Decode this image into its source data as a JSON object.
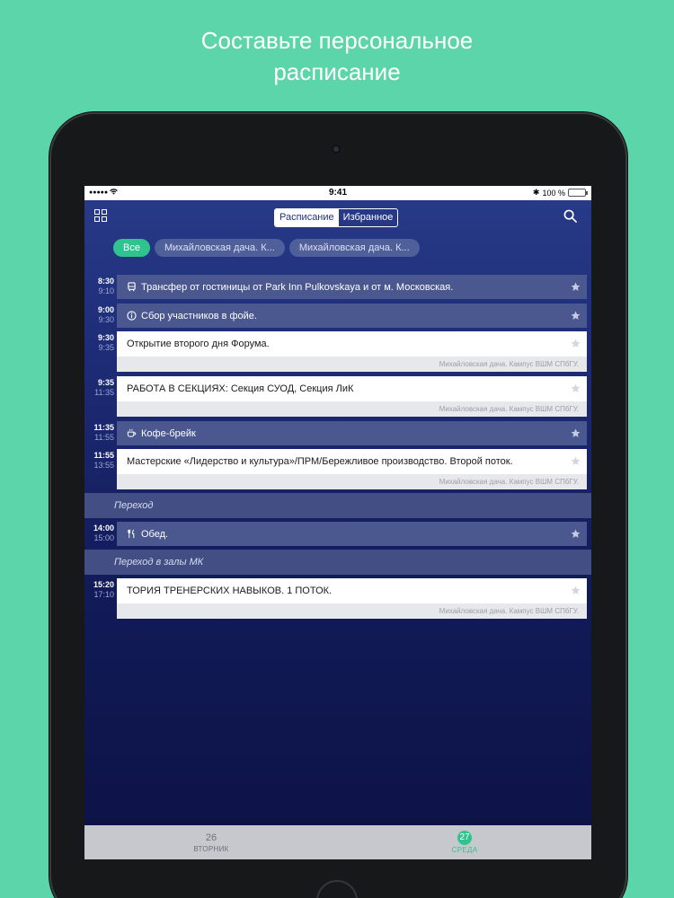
{
  "headline": {
    "line1": "Составьте персональное",
    "line2": "расписание"
  },
  "status_bar": {
    "signal": "●●●●●",
    "time": "9:41",
    "bluetooth": "✱",
    "battery": "100 %"
  },
  "nav": {
    "menu_icon": "grid-icon",
    "segments": [
      "Расписание",
      "Избранное"
    ],
    "active_segment": 0,
    "search_icon": "search-icon"
  },
  "filters": [
    "Все",
    "Михайловская дача. К...",
    "Михайловская дача. К..."
  ],
  "events": [
    {
      "start": "8:30",
      "end": "9:10",
      "type": "dark",
      "icon": "bus-icon",
      "title": "Трансфер от гостиницы от Park Inn Pulkovskaya и от м. Московская."
    },
    {
      "start": "9:00",
      "end": "9:30",
      "type": "dark",
      "icon": "info-icon",
      "title": "Сбор участников в фойе."
    },
    {
      "start": "9:30",
      "end": "9:35",
      "type": "white",
      "title": "Открытие второго дня Форума.",
      "location": "Михайловская дача. Кампус ВШМ СПбГУ."
    },
    {
      "start": "9:35",
      "end": "11:35",
      "type": "white",
      "title": "РАБОТА В СЕКЦИЯХ: Секция СУОД, Секция ЛиК",
      "location": "Михайловская дача. Кампус ВШМ СПбГУ."
    },
    {
      "start": "11:35",
      "end": "11:55",
      "type": "dark",
      "icon": "coffee-icon",
      "title": "Кофе-брейк"
    },
    {
      "start": "11:55",
      "end": "13:55",
      "type": "white",
      "title": "Мастерские «Лидерство и культура»/ПРМ/Бережливое производство. Второй поток.",
      "location": "Михайловская дача. Кампус ВШМ СПбГУ."
    },
    {
      "type": "divider",
      "title": "Переход"
    },
    {
      "start": "14:00",
      "end": "15:00",
      "type": "dark",
      "icon": "cutlery-icon",
      "title": "Обед."
    },
    {
      "type": "divider",
      "title": "Переход в залы МК"
    },
    {
      "start": "15:20",
      "end": "17:10",
      "type": "white",
      "title": "ТОРИЯ ТРЕНЕРСКИХ НАВЫКОВ. 1 ПОТОК.",
      "location": "Михайловская дача. Кампус ВШМ СПбГУ."
    }
  ],
  "tabs": [
    {
      "num": "26",
      "label": "ВТОРНИК"
    },
    {
      "num": "27",
      "label": "СРЕДА"
    }
  ],
  "active_tab": 1,
  "colors": {
    "background": "#5dd5ab",
    "accent": "#2fc48e",
    "screen_top": "#283b89",
    "screen_bottom": "#0c1245",
    "dark_card": "#4b578f"
  }
}
